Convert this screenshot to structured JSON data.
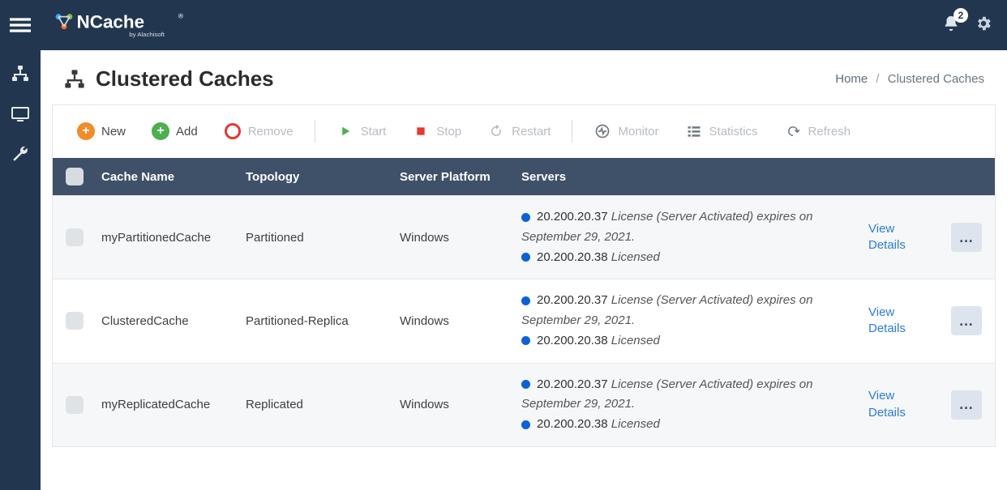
{
  "brand": {
    "name": "NCache",
    "sub": "by Alachisoft"
  },
  "header": {
    "title": "Clustered Caches",
    "notifications_count": "2",
    "breadcrumb": {
      "home": "Home",
      "current": "Clustered Caches"
    }
  },
  "toolbar": {
    "new": "New",
    "add": "Add",
    "remove": "Remove",
    "start": "Start",
    "stop": "Stop",
    "restart": "Restart",
    "monitor": "Monitor",
    "stats": "Statistics",
    "refresh": "Refresh"
  },
  "columns": {
    "name": "Cache Name",
    "topo": "Topology",
    "plat": "Server Platform",
    "serv": "Servers"
  },
  "viewLabel": "View Details",
  "rows": [
    {
      "name": "myPartitionedCache",
      "topo": "Partitioned",
      "plat": "Windows",
      "servers": [
        {
          "ip": "20.200.20.37",
          "status": "License (Server Activated) expires on September 29, 2021."
        },
        {
          "ip": "20.200.20.38",
          "status": "Licensed"
        }
      ]
    },
    {
      "name": "ClusteredCache",
      "topo": "Partitioned-Replica",
      "plat": "Windows",
      "servers": [
        {
          "ip": "20.200.20.37",
          "status": "License (Server Activated) expires on September 29, 2021."
        },
        {
          "ip": "20.200.20.38",
          "status": "Licensed"
        }
      ]
    },
    {
      "name": "myReplicatedCache",
      "topo": "Replicated",
      "plat": "Windows",
      "servers": [
        {
          "ip": "20.200.20.37",
          "status": "License (Server Activated) expires on September 29, 2021."
        },
        {
          "ip": "20.200.20.38",
          "status": "Licensed"
        }
      ]
    }
  ]
}
